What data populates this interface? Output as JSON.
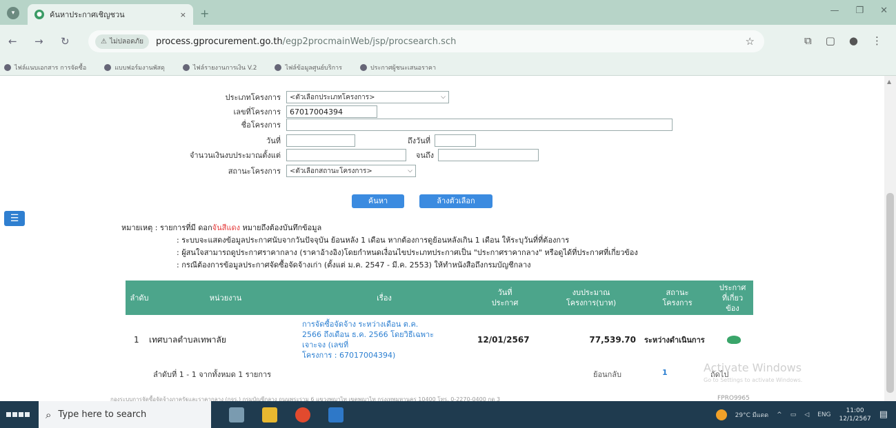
{
  "browser": {
    "tab_title": "ค้นหาประกาศเชิญชวน",
    "tab_close": "×",
    "new_tab": "+",
    "secure_label": "ไม่ปลอดภัย",
    "url_host": "process.gprocurement.go.th",
    "url_path": "/egp2procmainWeb/jsp/procsearch.sch",
    "bookmarks": [
      "ไฟล์แนบเอกสาร การจัดซื้อ",
      "แบบฟอร์มงานพัสดุ",
      "ไฟล์รายงานการเงิน V.2",
      "ไฟล์ข้อมูลศูนย์บริการ",
      "ประกาศผู้ชนะเสนอราคา"
    ]
  },
  "form": {
    "project_type_label": "ประเภทโครงการ",
    "project_type_value": "<ตัวเลือกประเภทโครงการ>",
    "project_no_label": "เลขที่โครงการ",
    "project_no_value": "67017004394",
    "project_name_label": "ชื่อโครงการ",
    "project_name_value": "",
    "date_label": "วันที่",
    "date_to_label": "ถึงวันที่",
    "budget_label": "จำนวนเงินงบประมาณตั้งแต่",
    "budget_to_label": "จนถึง",
    "status_label": "สถานะโครงการ",
    "status_value": "<ตัวเลือกสถานะโครงการ>",
    "search_button": "ค้นหา",
    "clear_button": "ล้างตัวเลือก"
  },
  "notes": {
    "prefix": "หมายเหตุ : รายการที่มี ดอก",
    "red_text": "จันสีแดง",
    "suffix": "หมายถึงต้องบันทึกข้อมูล",
    "line2": ": ระบบจะแสดงข้อมูลประกาศนับจากวันปัจจุบัน ย้อนหลัง 1 เดือน หากต้องการดูย้อนหลังเกิน 1 เดือน ให้ระบุวันที่ที่ต้องการ",
    "line3": ": ผู้สนใจสามารถดูประกาศราคากลาง (ราคาอ้างอิง)โดยกำหนดเงื่อนไขประเภทประกาศเป็น \"ประกาศราคากลาง\" หรือดูได้ที่ประกาศที่เกี่ยวข้อง",
    "line4": ": กรณีต้องการข้อมูลประกาศจัดซื้อจัดจ้างเก่า (ตั้งแต่ ม.ค. 2547 - มี.ค. 2553) ให้ทำหนังสือถึงกรมบัญชีกลาง"
  },
  "table": {
    "headers": {
      "no": "ลำดับ",
      "agency": "หน่วยงาน",
      "subject": "เรื่อง",
      "date_l1": "วันที่",
      "date_l2": "ประกาศ",
      "budget_l1": "งบประมาณ",
      "budget_l2": "โครงการ(บาท)",
      "status_l1": "สถานะ",
      "status_l2": "โครงการ",
      "related_l1": "ประกาศ",
      "related_l2": "ที่เกี่ยว",
      "related_l3": "ข้อง"
    },
    "row": {
      "no": "1",
      "agency": "เทศบาลตำบลเทพาลัย",
      "subject_l1": "การจัดซื้อจัดจ้าง ระหว่างเดือน ต.ค.",
      "subject_l2": "2566 ถึงเดือน ธ.ค. 2566 โดยวิธีเฉพาะ",
      "subject_l3": "เจาะจง (เลขที่",
      "subject_l4": "โครงการ : 67017004394)",
      "date": "12/01/2567",
      "budget": "77,539.70",
      "status": "ระหว่างดำเนินการ",
      "related_icon": "document-icon"
    },
    "summary": "ลำดับที่ 1 - 1 จากทั้งหมด 1 รายการ",
    "prev_label": "ย้อนกลับ",
    "page": "1",
    "next_label": "ถัดไป"
  },
  "footer": {
    "text": "กองระบบการจัดซื้อจัดจ้างภาครัฐและราคากลาง (กจร.) กรมบัญชีกลาง ถนนพระราม 6 แขวงพญาไท เขตพญาไท กรุงเทพมหานคร 10400 โทร. 0-2270-0400 กด 3",
    "code": "FPRO9965"
  },
  "watermark": {
    "title": "Activate Windows",
    "subtitle": "Go to Settings to activate Windows."
  },
  "taskbar": {
    "search_placeholder": "Type here to search",
    "weather": "29°C มีแดด",
    "lang": "ENG",
    "time": "11:00",
    "date": "12/1/2567"
  },
  "colors": {
    "table_header": "#4ca58b",
    "link": "#2c7fd1",
    "button": "#3b8be0",
    "taskbar": "#1f3b4f"
  }
}
